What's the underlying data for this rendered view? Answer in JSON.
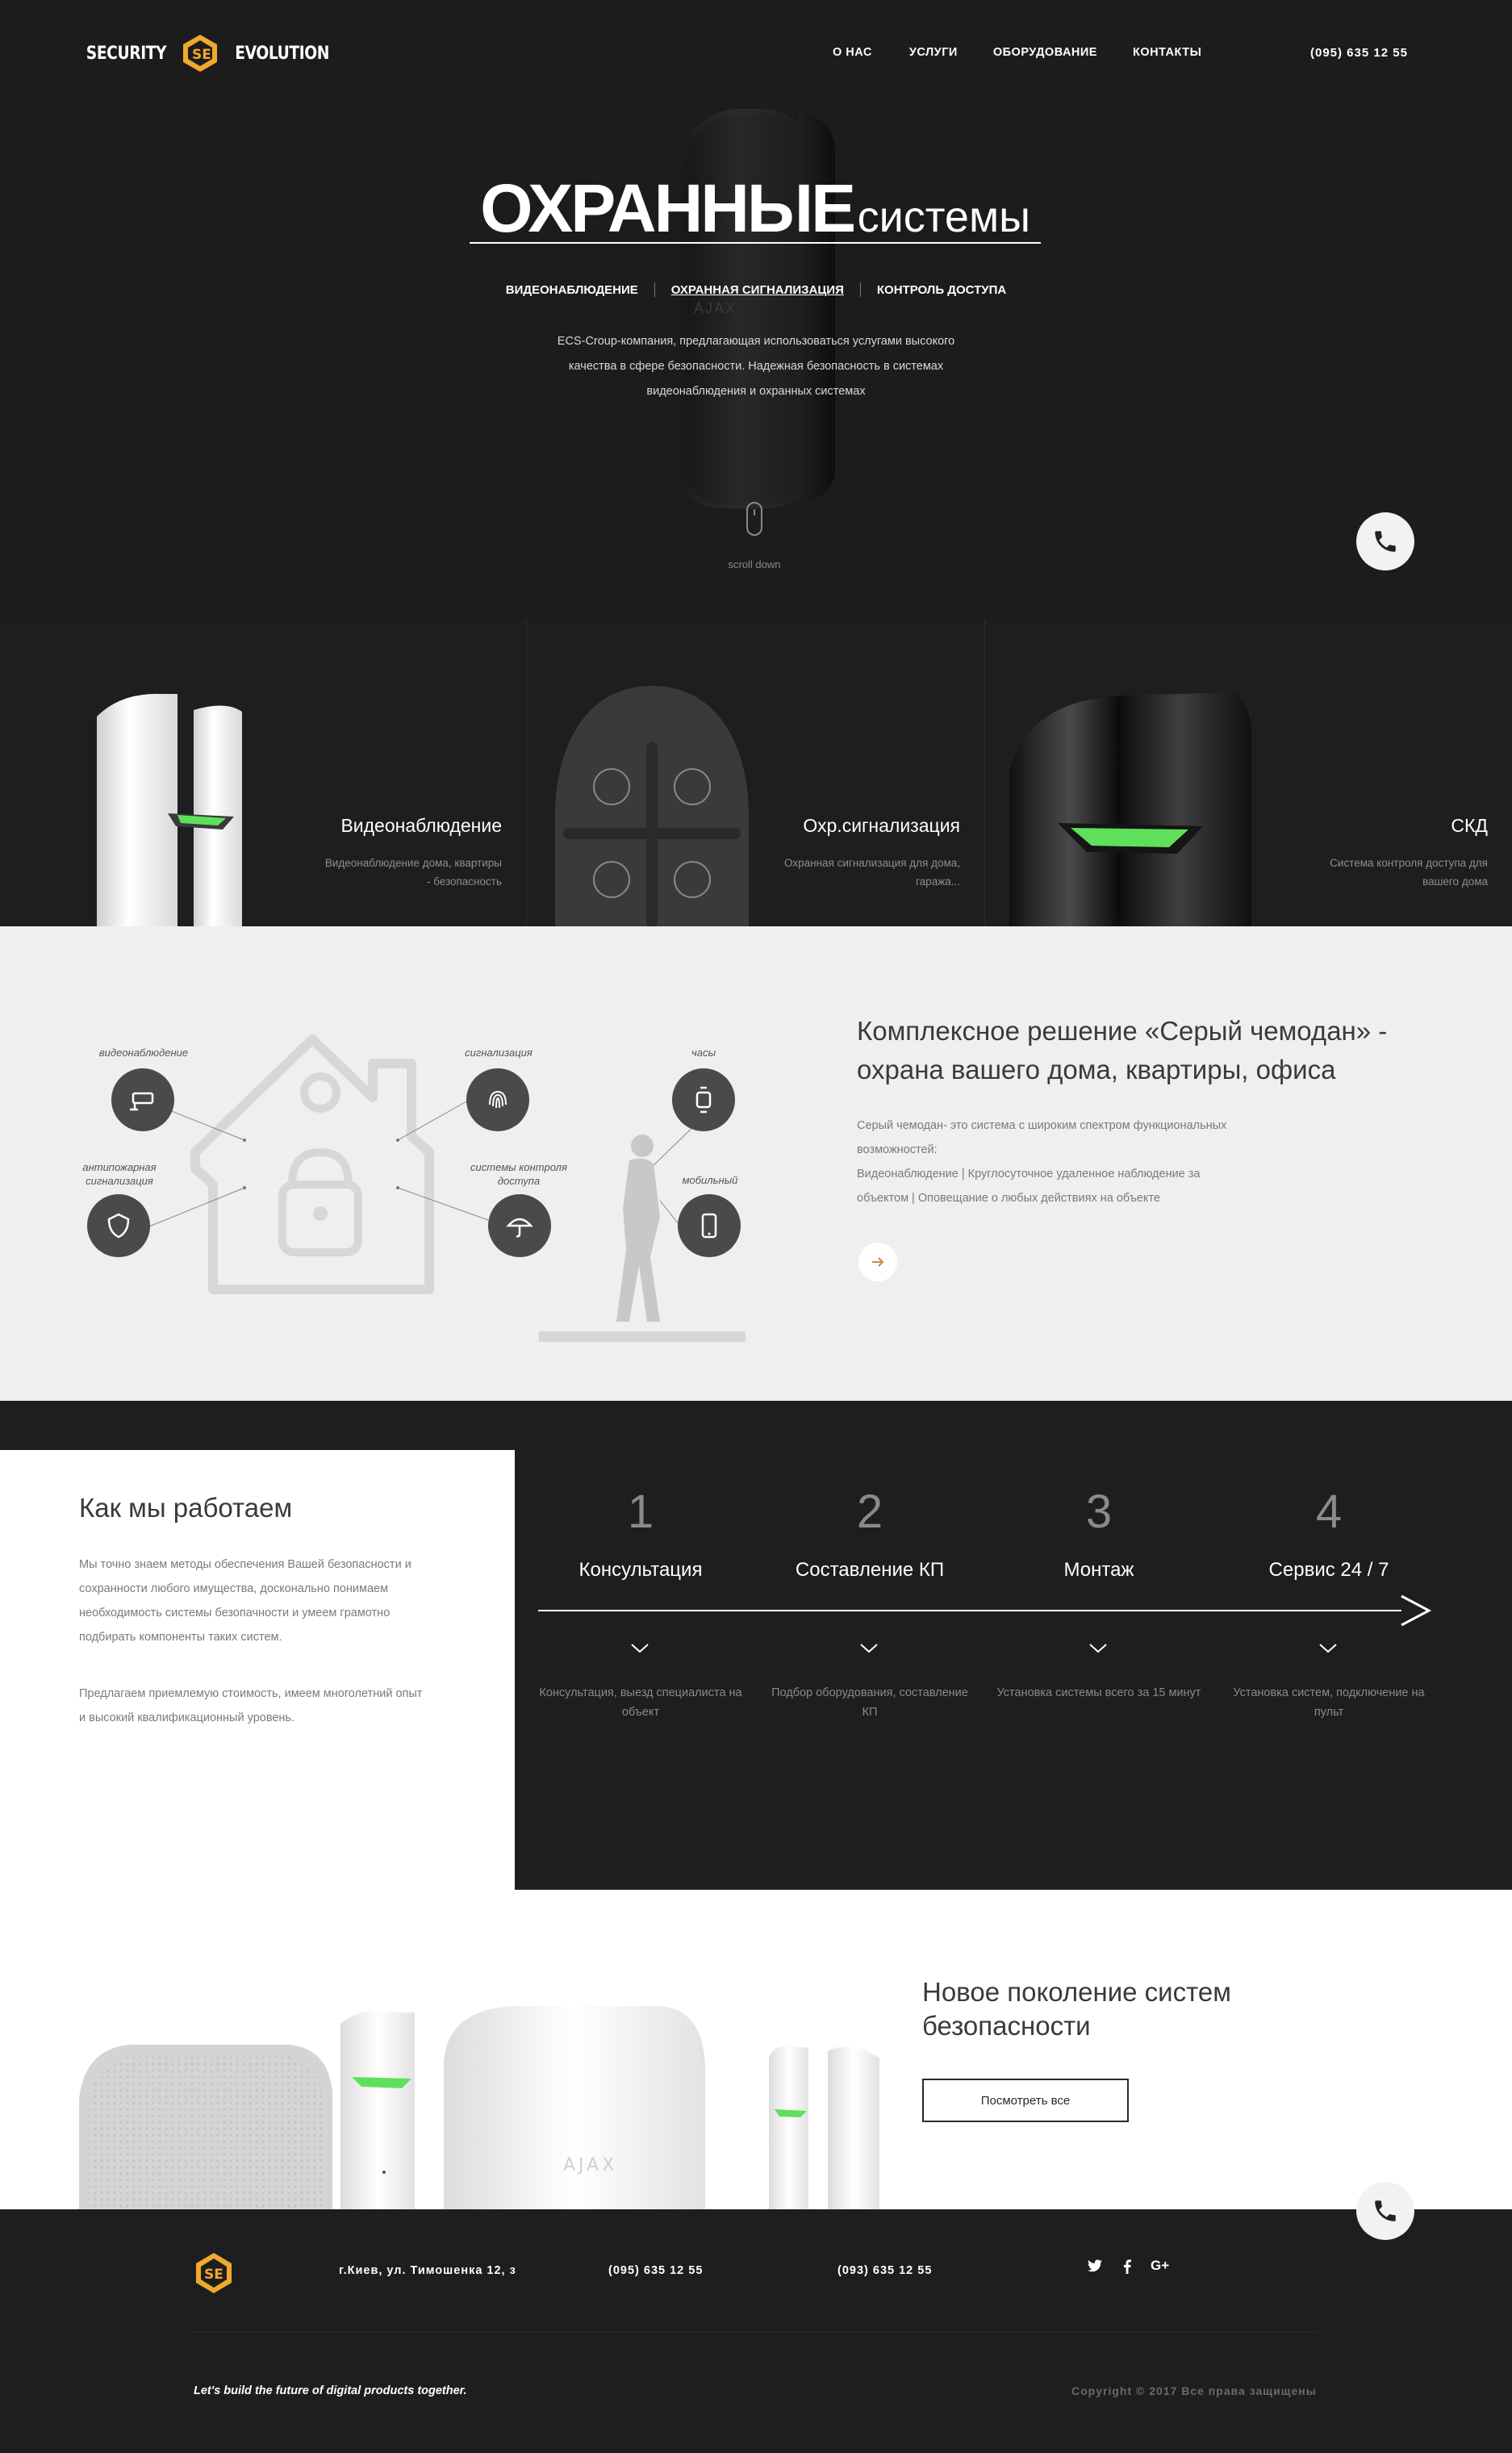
{
  "header": {
    "logo_left": "SECURITY",
    "logo_right": "EVOLUTION",
    "nav": [
      "О НАС",
      "УСЛУГИ",
      "ОБОРУДОВАНИЕ",
      "КОНТАКТЫ"
    ],
    "phone": "(095) 635 12 55"
  },
  "hero": {
    "title_bold": "ОХРАННЫЕ",
    "title_light": "системы",
    "links": [
      "ВИДЕОНАБЛЮДЕНИЕ",
      "ОХРАННАЯ СИГНАЛИЗАЦИЯ",
      "КОНТРОЛЬ ДОСТУПА"
    ],
    "active_link": "ОХРАННАЯ СИГНАЛИЗАЦИЯ",
    "description_lines": [
      "ECS-Croup-компания, предлагающая использоваться услугами высокого",
      "качества в сфере безопасности. Надежная безопасность в системах",
      "видеонаблюдения и охранных системах"
    ],
    "scroll_label": "scroll down",
    "device_brand": "AJAX"
  },
  "cards": [
    {
      "title": "Видеонаблюдение",
      "desc": "Видеонаблюдение дома, квартиры - безопасность"
    },
    {
      "title": "Охр.сигнализация",
      "desc": "Охранная сигнализация для дома, гаража..."
    },
    {
      "title": "СКД",
      "desc": "Система контроля доступа для вашего дома"
    }
  ],
  "complex": {
    "icons": [
      {
        "label": "видеонаблюдение",
        "icon": "cctv-camera-icon"
      },
      {
        "label": "сигнализация",
        "icon": "fingerprint-icon"
      },
      {
        "label": "антипожарная сигнализация",
        "icon": "shield-icon"
      },
      {
        "label": "системы контроля доступа",
        "icon": "umbrella-icon"
      },
      {
        "label": "часы",
        "icon": "smartwatch-icon"
      },
      {
        "label": "мобильный",
        "icon": "smartphone-icon"
      }
    ],
    "title": "Комплексное решение «Серый чемодан» - охрана вашего дома, квартиры, офиса",
    "text_lines": [
      "Серый чемодан- это система с широким спектром функциональных",
      "возможностей:",
      "Видеонаблюдение   |   Круглосуточное удаленное наблюдение за",
      "объектом   |   Оповещание о любых действиях на объекте"
    ]
  },
  "how": {
    "title": "Как мы работаем",
    "p1_lines": [
      "Мы точно знаем методы обеспечения Вашей безопасности и",
      "сохранности любого имущества, досконально понимаем",
      "необходимость системы безопачности и умеем грамотно",
      "подбирать компоненты таких систем."
    ],
    "p2_lines": [
      "Предлагаем приемлемую стоимость, имеем многолетний опыт",
      "и высокий квалификационный уровень."
    ],
    "steps": [
      {
        "num": "1",
        "title": "Консультация",
        "desc": "Консультация, выезд специалиста на объект"
      },
      {
        "num": "2",
        "title": "Составление КП",
        "desc": "Подбор оборудования, составление КП"
      },
      {
        "num": "3",
        "title": "Монтаж",
        "desc": "Установка системы всего за 15 минут"
      },
      {
        "num": "4",
        "title": "Сервис 24 / 7",
        "desc": "Установка систем, подключение на пульт"
      }
    ]
  },
  "product": {
    "title": "Новое поколение систем безопасности",
    "button": "Посмотреть все",
    "hub_brand": "AJAX"
  },
  "footer": {
    "address": "г.Киев, ул. Тимошенка 12, з",
    "phone1": "(095) 635 12 55",
    "phone2": "(093) 635 12 55",
    "social": [
      "twitter-icon",
      "facebook-icon",
      "google-plus-icon"
    ],
    "slogan": "Let's build the future of digital products together.",
    "copyright": "Copyright © 2017 Все права защищены"
  },
  "colors": {
    "dark": "#1e1e20",
    "light_section": "#efefef",
    "accent_green": "#5fe05a",
    "logo_orange": "#f0a92a"
  }
}
